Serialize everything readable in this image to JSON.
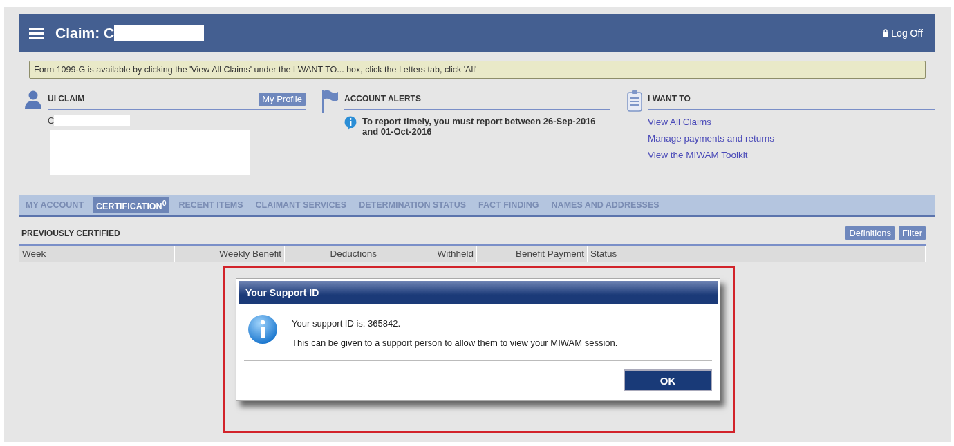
{
  "header": {
    "title": "Claim: C",
    "logoff": "Log Off"
  },
  "notice": "Form 1099-G is available by clicking the 'View All Claims' under the I WANT TO... box, click the Letters tab, click 'All'",
  "ui_claim": {
    "heading": "UI CLAIM",
    "profile_button": "My Profile",
    "name": "C"
  },
  "account_alerts": {
    "heading": "ACCOUNT ALERTS",
    "message": "To report timely, you must report between 26-Sep-2016 and 01-Oct-2016"
  },
  "i_want_to": {
    "heading": "I WANT TO",
    "links": [
      "View All Claims",
      "Manage payments and returns",
      "View the MIWAM Toolkit"
    ]
  },
  "tabs": [
    {
      "label": "MY ACCOUNT",
      "selected": false
    },
    {
      "label": "CERTIFICATION$^{0}$",
      "selected": true
    },
    {
      "label": "RECENT ITEMS",
      "selected": false
    },
    {
      "label": "CLAIMANT SERVICES",
      "selected": false
    },
    {
      "label": "DETERMINATION STATUS",
      "selected": false
    },
    {
      "label": "FACT FINDING",
      "selected": false
    },
    {
      "label": "NAMES AND ADDRESSES",
      "selected": false
    }
  ],
  "section": {
    "title": "PREVIOUSLY CERTIFIED",
    "buttons": [
      "Definitions",
      "Filter"
    ]
  },
  "table": {
    "columns": [
      "Week",
      "Weekly Benefit",
      "Deductions",
      "Withheld",
      "Benefit Payment",
      "Status"
    ]
  },
  "dialog": {
    "title": "Your Support ID",
    "lines": [
      "Your support ID is: 365842.",
      "This can be given to a support person to allow them to view your MIWAM session."
    ],
    "button": "OK"
  }
}
